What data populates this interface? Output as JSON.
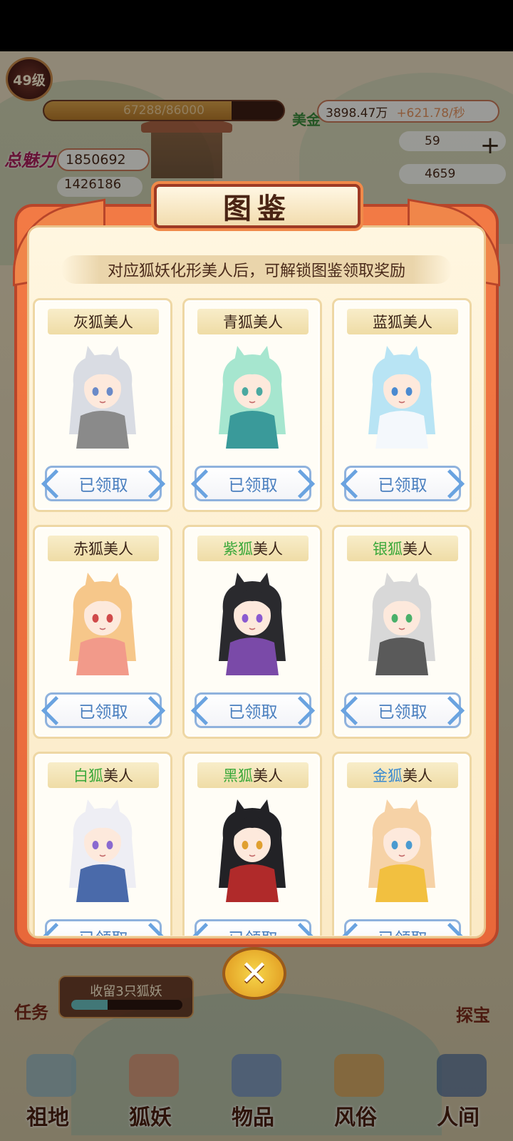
{
  "hud": {
    "level": "49级",
    "exp_text": "67288/86000",
    "exp_progress": 0.782,
    "charm_label": "总魅力",
    "charm_value": "1850692",
    "second_value": "1426186",
    "gold_label": "美金",
    "gold_value": "3898.47万",
    "gold_rate": "+621.78/秒",
    "res1": "59",
    "res2": "4659",
    "plus": "+"
  },
  "task": {
    "label": "任务",
    "text": "收留3只狐妖",
    "progress": 0.33
  },
  "treasure_label": "探宝",
  "nav": [
    {
      "label": "祖地"
    },
    {
      "label": "狐妖"
    },
    {
      "label": "物品"
    },
    {
      "label": "风俗"
    },
    {
      "label": "人间"
    }
  ],
  "dialog": {
    "title": "图鉴",
    "subtitle": "对应狐妖化形美人后，可解锁图鉴领取奖励",
    "close_symbol": "✕",
    "cards": [
      {
        "prefix": "灰狐",
        "suffix": "美人",
        "prefix_color": "#3a2418",
        "button": "已领取",
        "hair": "#d9dce3",
        "dress": "#8a8a8a",
        "eye": "#6a8ac8"
      },
      {
        "prefix": "青狐",
        "suffix": "美人",
        "prefix_color": "#3a2418",
        "button": "已领取",
        "hair": "#a6e6cf",
        "dress": "#3a9a9a",
        "eye": "#4aa8a0"
      },
      {
        "prefix": "蓝狐",
        "suffix": "美人",
        "prefix_color": "#3a2418",
        "button": "已领取",
        "hair": "#b8e4f4",
        "dress": "#f4f8fc",
        "eye": "#4a8ad0"
      },
      {
        "prefix": "赤狐",
        "suffix": "美人",
        "prefix_color": "#3a2418",
        "button": "已领取",
        "hair": "#f6c78a",
        "dress": "#f29a8a",
        "eye": "#d04a4a"
      },
      {
        "prefix": "紫狐",
        "suffix": "美人",
        "prefix_color": "#3aa83a",
        "button": "已领取",
        "hair": "#2a2a2e",
        "dress": "#7a4aa8",
        "eye": "#8a5ad0"
      },
      {
        "prefix": "银狐",
        "suffix": "美人",
        "prefix_color": "#3aa83a",
        "button": "已领取",
        "hair": "#d8d8d8",
        "dress": "#5a5a5a",
        "eye": "#4ab06a"
      },
      {
        "prefix": "白狐",
        "suffix": "美人",
        "prefix_color": "#3aa83a",
        "button": "已领取",
        "hair": "#eeeef4",
        "dress": "#4a6aaa",
        "eye": "#8a6ad0"
      },
      {
        "prefix": "黑狐",
        "suffix": "美人",
        "prefix_color": "#3aa83a",
        "button": "已领取",
        "hair": "#222226",
        "dress": "#b02a2a",
        "eye": "#e0a030"
      },
      {
        "prefix": "金狐",
        "suffix": "美人",
        "prefix_color": "#3a8ad0",
        "button": "已领取",
        "hair": "#f6d2a6",
        "dress": "#f2c040",
        "eye": "#4a9ad0"
      }
    ]
  }
}
